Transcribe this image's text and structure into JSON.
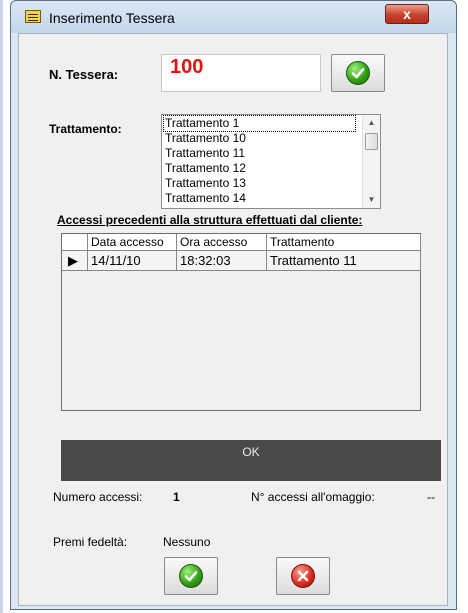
{
  "window": {
    "title": "Inserimento Tessera",
    "close_glyph": "x"
  },
  "tessera": {
    "label": "N. Tessera:",
    "value": "100"
  },
  "trattamento": {
    "label": "Trattamento:",
    "options": [
      "Trattamento 1",
      "Trattamento 10",
      "Trattamento 11",
      "Trattamento 12",
      "Trattamento 13",
      "Trattamento 14"
    ],
    "selected": "Trattamento 1"
  },
  "accessi": {
    "title": "Accessi precedenti alla struttura effettuati dal cliente:",
    "columns": [
      "Data accesso",
      "Ora accesso",
      "Trattamento"
    ],
    "rows": [
      {
        "indicator": "▶",
        "data": "14/11/10",
        "ora": "18:32:03",
        "trattamento": "Trattamento 11"
      }
    ]
  },
  "ok_bar": {
    "label": "OK"
  },
  "stats": {
    "numero_label": "Numero accessi:",
    "numero_value": "1",
    "omaggio_label": "N° accessi all'omaggio:",
    "omaggio_value": "--"
  },
  "premi": {
    "label": "Premi fedeltà:",
    "value": "Nessuno"
  },
  "icons": {
    "confirm": "check-circle-icon",
    "cancel": "x-circle-icon",
    "title": "card-icon"
  },
  "colors": {
    "tessera_value": "#e81010",
    "ok_bar": "#4a4a4a",
    "confirm": "#2e9a12",
    "cancel": "#d8281c"
  }
}
